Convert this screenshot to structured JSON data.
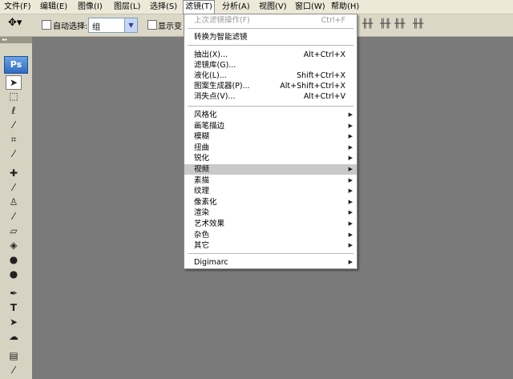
{
  "menubar": [
    {
      "label": "文件(F)"
    },
    {
      "label": "编辑(E)"
    },
    {
      "label": "图像(I)"
    },
    {
      "label": "图层(L)"
    },
    {
      "label": "选择(S)"
    },
    {
      "label": "滤镜(T)"
    },
    {
      "label": "分析(A)"
    },
    {
      "label": "视图(V)"
    },
    {
      "label": "窗口(W)"
    },
    {
      "label": "帮助(H)"
    }
  ],
  "options": {
    "auto_select_label": "自动选择:",
    "auto_select_value": "组",
    "show_transform_label": "显示变"
  },
  "toolbox": {
    "logo": "Ps"
  },
  "filter_menu": {
    "last_filter": {
      "label": "上次滤镜操作(F)",
      "shortcut": "Ctrl+F"
    },
    "smart": {
      "label": "转换为智能滤镜"
    },
    "top": [
      {
        "label": "抽出(X)...",
        "shortcut": "Alt+Ctrl+X"
      },
      {
        "label": "滤镜库(G)...",
        "shortcut": ""
      },
      {
        "label": "液化(L)...",
        "shortcut": "Shift+Ctrl+X"
      },
      {
        "label": "图案生成器(P)...",
        "shortcut": "Alt+Shift+Ctrl+X"
      },
      {
        "label": "消失点(V)...",
        "shortcut": "Alt+Ctrl+V"
      }
    ],
    "submenus": [
      {
        "label": "风格化"
      },
      {
        "label": "画笔描边"
      },
      {
        "label": "模糊"
      },
      {
        "label": "扭曲"
      },
      {
        "label": "锐化"
      },
      {
        "label": "视频"
      },
      {
        "label": "素描"
      },
      {
        "label": "纹理"
      },
      {
        "label": "像素化"
      },
      {
        "label": "渲染"
      },
      {
        "label": "艺术效果"
      },
      {
        "label": "杂色"
      },
      {
        "label": "其它"
      }
    ],
    "digimarc": {
      "label": "Digimarc"
    },
    "submenu_arrow": "▶"
  }
}
